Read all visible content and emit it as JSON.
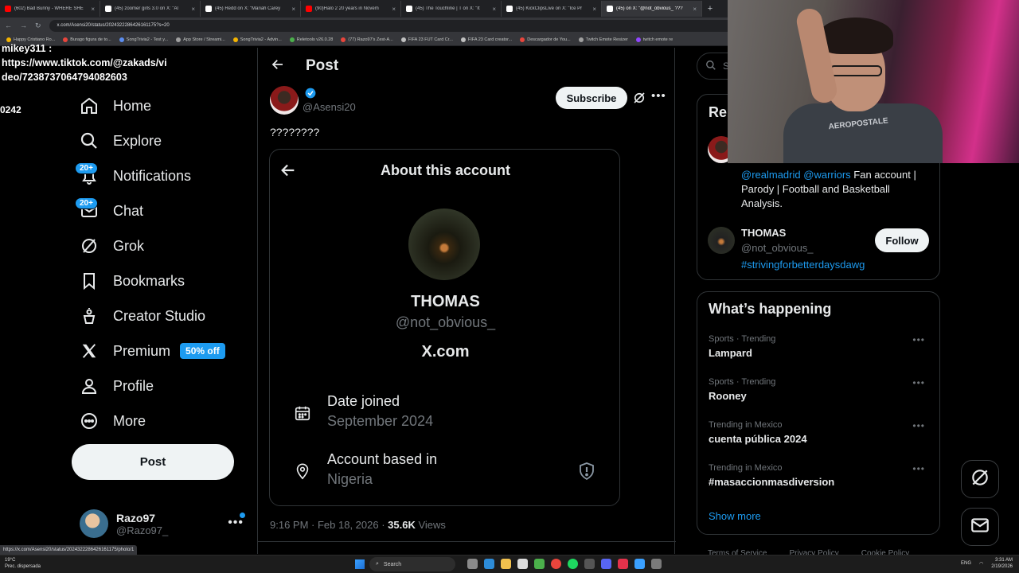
{
  "browser": {
    "tabs": [
      {
        "title": "(602) Bad Bunny - WHERE SHE",
        "color": "#ff0000",
        "active": false
      },
      {
        "title": "(45) zoomer girls 3.0 on X: \"Al",
        "color": "#ffffff",
        "active": false
      },
      {
        "title": "(45) Redd on X: \"Mariah Carey",
        "color": "#ffffff",
        "active": false
      },
      {
        "title": "(90)Halo 2 20 years in Novem",
        "color": "#ff0000",
        "active": false
      },
      {
        "title": "(45) The Touchline | T on X: \"It",
        "color": "#ffffff",
        "active": false
      },
      {
        "title": "(45) KickClipsLive on X: \"Ice Pr",
        "color": "#ffffff",
        "active": false
      },
      {
        "title": "(45) on X: \"@not_obvious_ ???",
        "color": "#ffffff",
        "active": true
      }
    ],
    "url": "x.com/Asensi20/status/2024322286426161175?s=20",
    "bookmarks": [
      "Happy Cristiano Ro...",
      "Burago figura de to...",
      "SongTrivia2 - Test y...",
      "App Store / Streami...",
      "SongTrivia2 - Advin...",
      "Reletools v26.0.28",
      "(77) Razo97's Zest-A...",
      "FIFA 23 FUT Card Cr...",
      "FIFA 23 Card creator...",
      "Descargador de You...",
      "Twitch Emote Resizer",
      "twitch emote re"
    ],
    "status_url": "https://x.com/Asensi20/status/2024322286426161175/photo/1"
  },
  "overlay": {
    "chat_user": "mikey311 :",
    "chat_line1": "https://www.tiktok.com/@zakads/vi",
    "chat_line2": "deo/7238737064794082603",
    "number": "0242"
  },
  "nav": {
    "items": [
      {
        "label": "Home",
        "icon": "home-icon"
      },
      {
        "label": "Explore",
        "icon": "search-icon"
      },
      {
        "label": "Notifications",
        "icon": "bell-icon",
        "badge": "20+"
      },
      {
        "label": "Chat",
        "icon": "mail-icon",
        "badge": "20+"
      },
      {
        "label": "Grok",
        "icon": "grok-icon"
      },
      {
        "label": "Bookmarks",
        "icon": "bookmark-icon"
      },
      {
        "label": "Creator Studio",
        "icon": "creator-studio-icon"
      },
      {
        "label": "Premium",
        "icon": "x-logo-icon",
        "promo": "50% off"
      },
      {
        "label": "Profile",
        "icon": "profile-icon"
      },
      {
        "label": "More",
        "icon": "more-circle-icon"
      }
    ],
    "post_label": "Post",
    "account": {
      "name": "Razo97",
      "handle": "@Razo97_"
    }
  },
  "post": {
    "header_title": "Post",
    "author_handle": "@Asensi20",
    "subscribe_label": "Subscribe",
    "text": "????????",
    "card": {
      "title": "About this account",
      "name": "THOMAS",
      "handle": "@not_obvious_",
      "site": "X.com",
      "date_joined_label": "Date joined",
      "date_joined_value": "September 2024",
      "based_in_label": "Account based in",
      "based_in_value": "Nigeria"
    },
    "time": "9:16 PM · Feb 18, 2026 ·",
    "views_count": "35.6K",
    "views_label": "Views"
  },
  "sidebar": {
    "search_placeholder": "Se",
    "relevant": {
      "title": "Rel",
      "bio_link1": "@realmadrid",
      "bio_link2": "@warriors",
      "bio_text": "Fan account | Parody | Football and Basketball Analysis.",
      "name": "THOMAS",
      "handle": "@not_obvious_",
      "tag": "#strivingforbetterdaysdawg",
      "follow_label": "Follow"
    },
    "whats_happening": {
      "title": "What’s happening",
      "trends": [
        {
          "meta": "Sports · Trending",
          "name": "Lampard"
        },
        {
          "meta": "Sports · Trending",
          "name": "Rooney"
        },
        {
          "meta": "Trending in Mexico",
          "name": "cuenta pública 2024"
        },
        {
          "meta": "Trending in Mexico",
          "name": "#masaccionmasdiversion"
        }
      ],
      "show_more": "Show more"
    },
    "footer": [
      "Terms of Service",
      "Privacy Policy",
      "Cookie Policy"
    ]
  },
  "webcam": {
    "shirt_text": "AEROPOSTALE"
  },
  "taskbar": {
    "weather_temp": "19°C",
    "weather_desc": "Prec. dispersada",
    "search_label": "Search",
    "lang": "ENG",
    "time": "3:31 AM",
    "date": "2/19/2026"
  },
  "colors": {
    "accent": "#1d9bf0",
    "background": "#000000",
    "border": "#2f3336",
    "muted": "#71767b"
  }
}
